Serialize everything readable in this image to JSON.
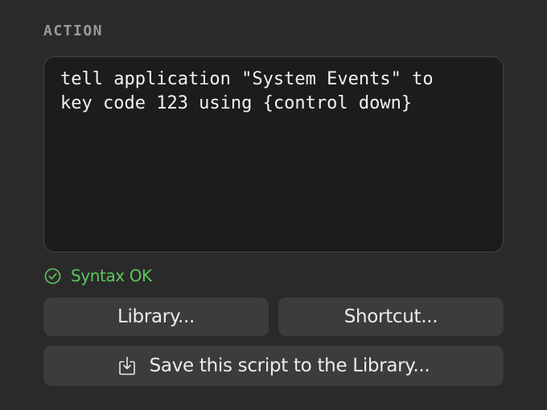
{
  "section": {
    "label": "ACTION"
  },
  "editor": {
    "code": "tell application \"System Events\" to\nkey code 123 using {control down}"
  },
  "status": {
    "icon": "checkmark-circle-icon",
    "text": "Syntax OK",
    "color": "#5cc75c"
  },
  "buttons": {
    "library_label": "Library...",
    "shortcut_label": "Shortcut...",
    "save_label": "Save this script to the Library...",
    "save_icon": "save-to-tray-icon"
  }
}
